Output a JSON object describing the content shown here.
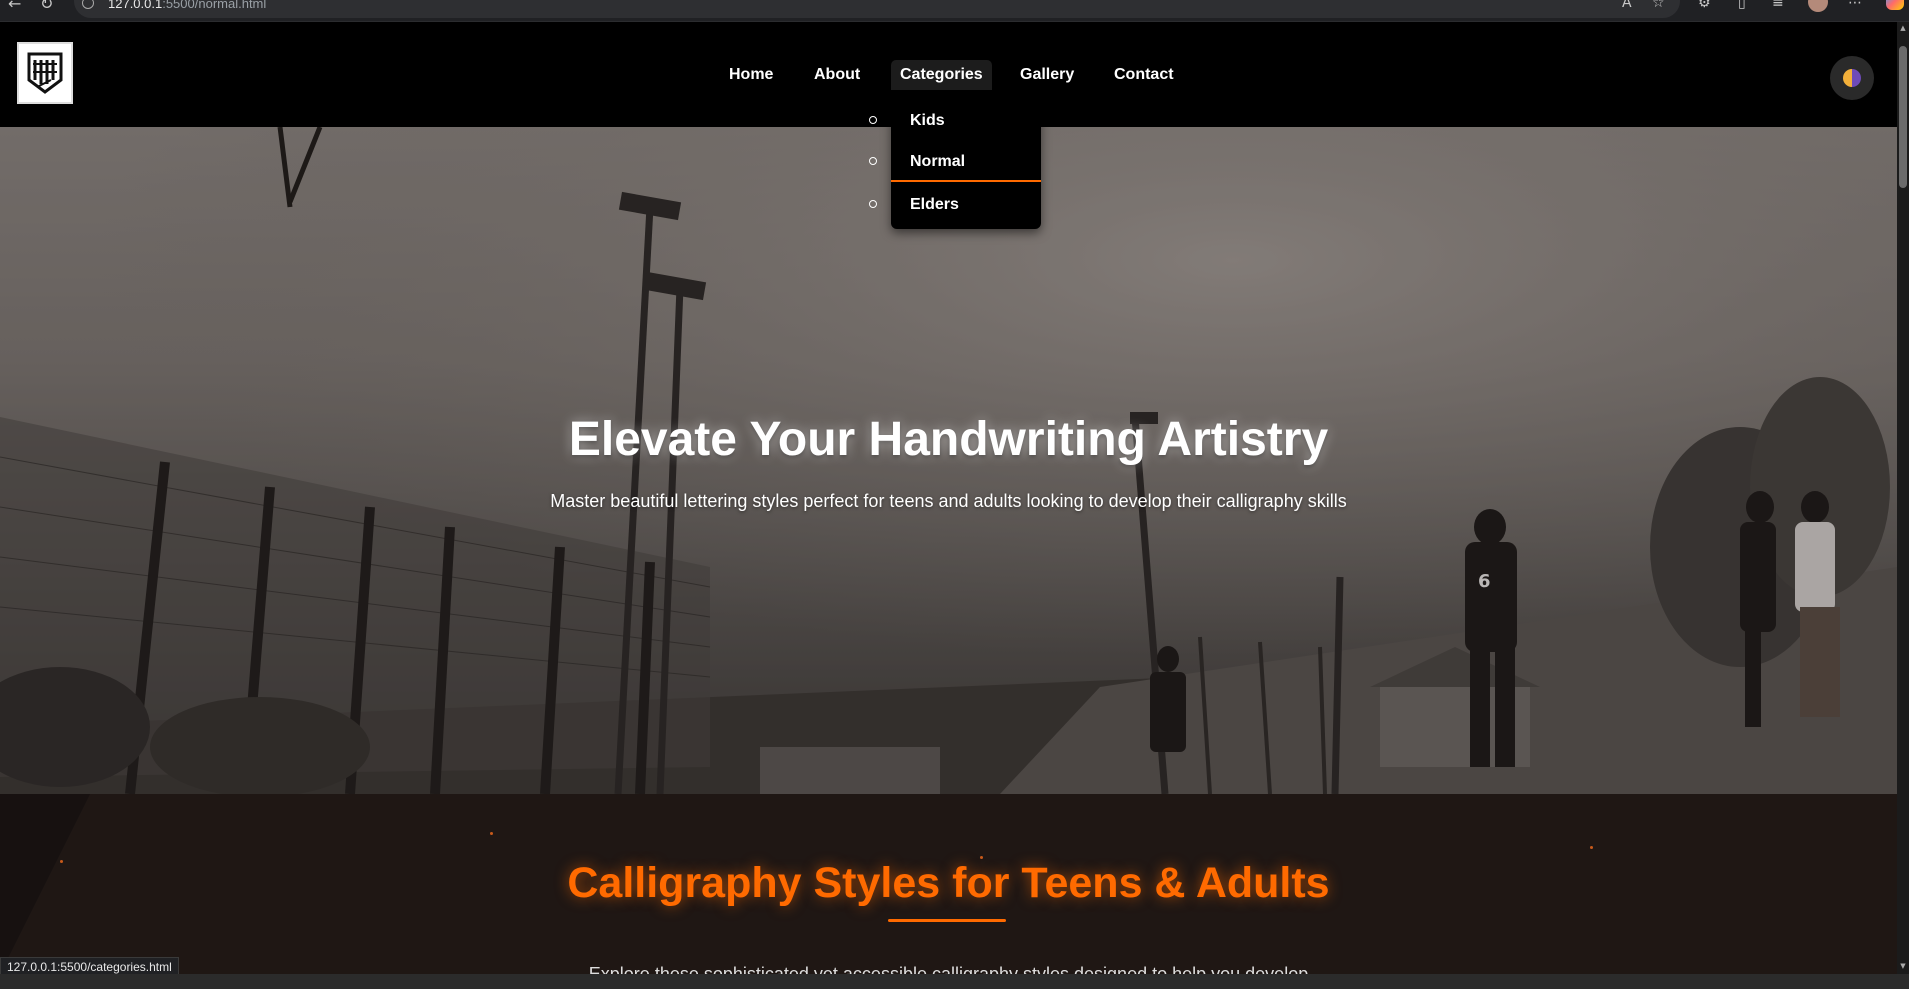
{
  "browser": {
    "url_host": "127.0.0.1",
    "url_rest": ":5500/normal.html",
    "status_url": "127.0.0.1:5500/categories.html"
  },
  "nav": {
    "items": [
      {
        "label": "Home"
      },
      {
        "label": "About"
      },
      {
        "label": "Categories"
      },
      {
        "label": "Gallery"
      },
      {
        "label": "Contact"
      }
    ],
    "dropdown": [
      {
        "label": "Kids"
      },
      {
        "label": "Normal"
      },
      {
        "label": "Elders"
      }
    ]
  },
  "hero": {
    "title": "Elevate Your Handwriting Artistry",
    "subtitle": "Master beautiful lettering styles perfect for teens and adults looking to develop their calligraphy skills"
  },
  "section": {
    "title": "Calligraphy Styles for Teens & Adults",
    "intro": "Explore these sophisticated yet accessible calligraphy styles designed to help you develop"
  },
  "colors": {
    "accent": "#ff6a00",
    "header_bg": "#000000",
    "section_bg": "#1f1714"
  },
  "icons": {
    "logo": "calligraphy-logo-icon",
    "theme": "theme-toggle-icon"
  }
}
